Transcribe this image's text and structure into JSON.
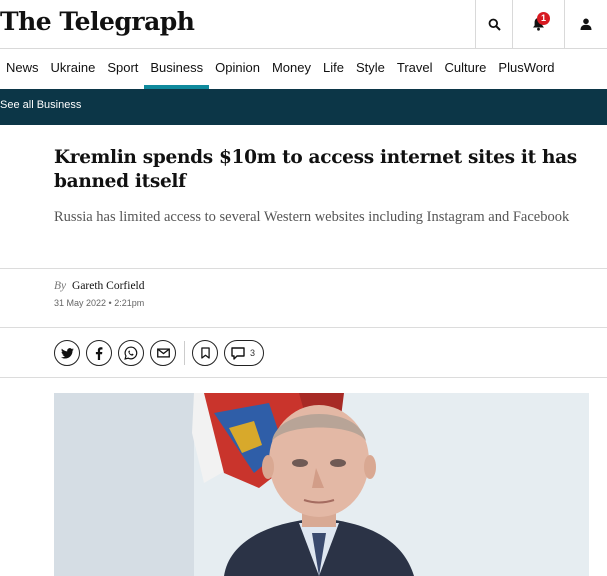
{
  "header": {
    "logo": "The Telegraph",
    "search_icon": "search-icon",
    "bell_icon": "bell-icon",
    "notification_count": "1",
    "account_icon": "user-icon",
    "accent": "#d71a21"
  },
  "nav": {
    "items": [
      "News",
      "Ukraine",
      "Sport",
      "Business",
      "Opinion",
      "Money",
      "Life",
      "Style",
      "Travel",
      "Culture",
      "PlusWord"
    ],
    "active": "Business",
    "accent": "#0f8a9d"
  },
  "subnav": {
    "link": "See all Business",
    "background": "#0c3647"
  },
  "article": {
    "headline": "Kremlin spends $10m to access internet sites it has banned itself",
    "standfirst": "Russia has limited access to several Western websites including Instagram and Facebook",
    "byline_prefix": "By",
    "author": "Gareth Corfield",
    "date": "31 May 2022 • 2:21pm"
  },
  "share": {
    "icons": [
      "twitter-icon",
      "facebook-icon",
      "whatsapp-icon",
      "email-icon",
      "bookmark-icon",
      "comment-icon"
    ],
    "comment_count": "3"
  }
}
